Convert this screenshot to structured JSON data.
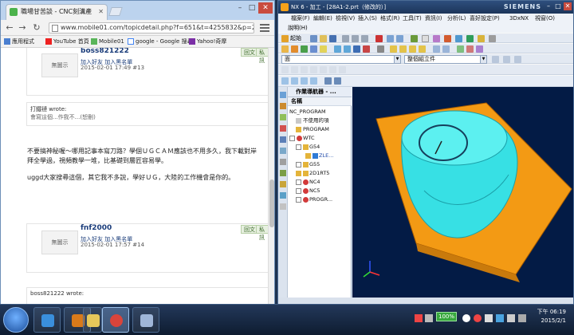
{
  "chrome": {
    "tab_title": "職場甘苦談 - CNC刻溝產",
    "url": "www.mobile01.com/topicdetail.php?f=651&t=4255832&p=2",
    "bookmarks": [
      "應用程式",
      "YouTube 首頁",
      "Mobile01",
      "google - Google 搜尋",
      "Yahoo!奇摩"
    ]
  },
  "posts": [
    {
      "username": "boss821222",
      "avatar": "無圖示",
      "links": "加入好友  加入黑名單",
      "date": "2015-02-01 17:49  #13",
      "quote_author": "打鐵褳 wrote:",
      "quote_text": "會寫這個...作我不...(恕刪)",
      "body": [
        "不要搞神秘喔～哪用記事本寫刀路？學個ＵＧＣＡＭ應該也不用多久，我下載對岸",
        "拜全學過，視頻教學一堆，比基礎到層匠容易學。",
        "uggd大家搜尋這個，其它我不多說，學好ＵＧ，大陸的工作機會是你的。"
      ],
      "buttons": [
        "回文",
        "私訊"
      ]
    },
    {
      "username": "fnf2000",
      "avatar": "無圖示",
      "links": "加入好友  加入黑名單",
      "date": "2015-02-01 17:57  #14",
      "quote_author": "boss821222 wrote:",
      "buttons": [
        "回文",
        "私訊"
      ]
    }
  ],
  "nx": {
    "title": "NX 6 - 加工 - [28A1-2.prt（修改的）]",
    "brand": "SIEMENS",
    "menu": [
      "檔案(F)",
      "編輯(E)",
      "檢視(V)",
      "插入(S)",
      "格式(R)",
      "工具(T)",
      "資訊(I)",
      "分析(L)",
      "喜好設定(P)",
      "3DxNX",
      "視窗(O)"
    ],
    "menu2": "說明(H)",
    "start_label": "起始",
    "filter_select": "面",
    "scope_select": "整個組立件",
    "navigator_title": "作業導航器 - ...",
    "column_header": "名稱",
    "tree": [
      {
        "label": "NC_PROGRAM",
        "level": 0
      },
      {
        "label": "不使用的項",
        "level": 1
      },
      {
        "label": "PROGRAM",
        "level": 1
      },
      {
        "label": "WTC",
        "level": 1
      },
      {
        "label": "G54",
        "level": 2
      },
      {
        "label": "ZLE...",
        "level": 3
      },
      {
        "label": "G55",
        "level": 2
      },
      {
        "label": "2D1RT5",
        "level": 2
      },
      {
        "label": "NC4",
        "level": 2
      },
      {
        "label": "NC5",
        "level": 2
      },
      {
        "label": "PROGR...",
        "level": 2
      }
    ]
  },
  "taskbar": {
    "battery": "100%",
    "time": "下午 06:19",
    "date": "2015/2/1"
  },
  "colors": {
    "viewport_bg": "#031b45",
    "part_cyan": "#37e0e4",
    "stock_orange": "#f39a14"
  }
}
